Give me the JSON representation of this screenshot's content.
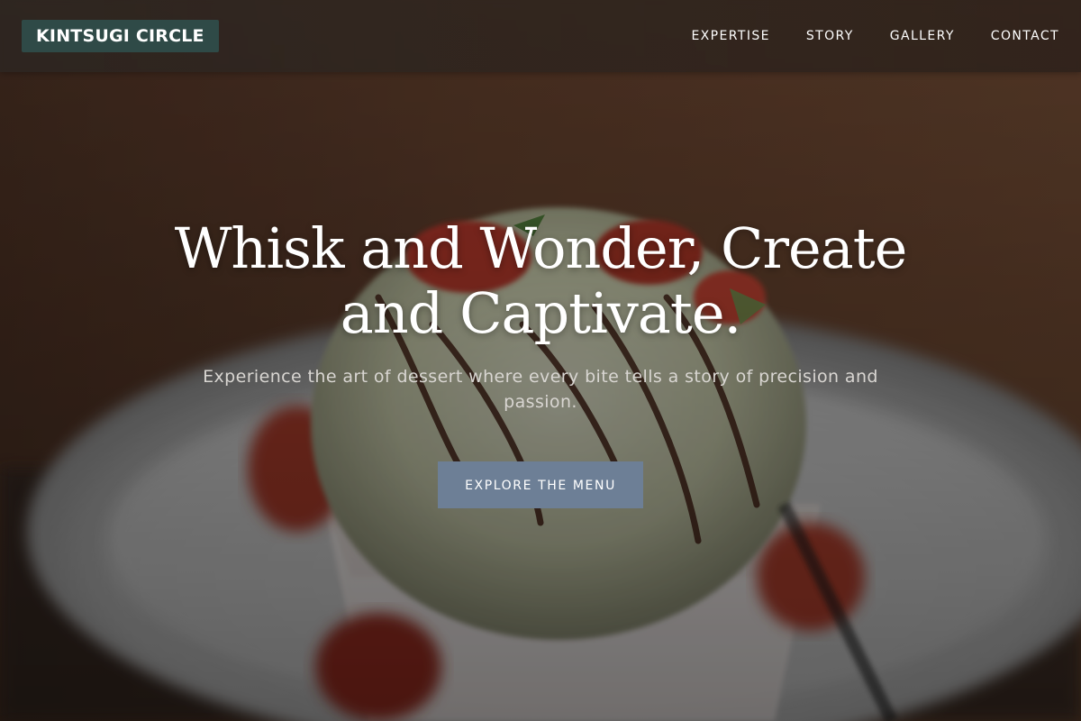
{
  "header": {
    "logo_text": "KINTSUGI CIRCLE",
    "nav": [
      {
        "label": "EXPERTISE"
      },
      {
        "label": "STORY"
      },
      {
        "label": "GALLERY"
      },
      {
        "label": "CONTACT"
      }
    ]
  },
  "hero": {
    "title": "Whisk and Wonder, Create and Captivate.",
    "subtitle": "Experience the art of dessert where every bite tells a story of precision and passion.",
    "cta_label": "EXPLORE THE MENU"
  },
  "colors": {
    "logo_bg": "#2f4a47",
    "cta_bg": "#6d7f96",
    "text_primary": "#ffffff",
    "text_secondary": "#d9d6d2"
  },
  "background": {
    "subject": "ice cream scoop with chocolate drizzle and strawberries on a plate"
  }
}
